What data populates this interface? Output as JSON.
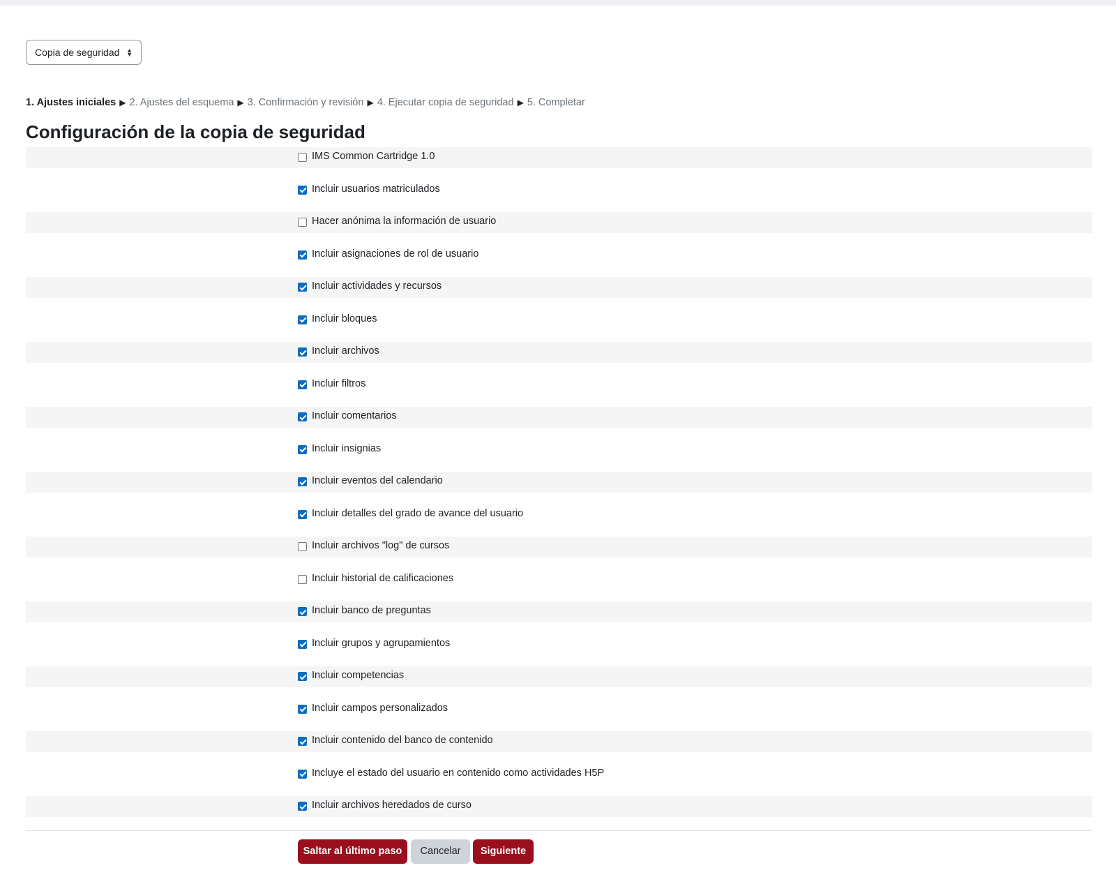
{
  "jump_select": {
    "selected": "Copia de seguridad"
  },
  "breadcrumb": {
    "steps": [
      {
        "label": "1. Ajustes iniciales",
        "current": true
      },
      {
        "label": "2. Ajustes del esquema",
        "current": false
      },
      {
        "label": "3. Confirmación y revisión",
        "current": false
      },
      {
        "label": "4. Ejecutar copia de seguridad",
        "current": false
      },
      {
        "label": "5. Completar",
        "current": false
      }
    ],
    "separator": "▶"
  },
  "page_title": "Configuración de la copia de seguridad",
  "settings": [
    {
      "label": "IMS Common Cartridge 1.0",
      "checked": false
    },
    {
      "label": "Incluir usuarios matriculados",
      "checked": true
    },
    {
      "label": "Hacer anónima la información de usuario",
      "checked": false
    },
    {
      "label": "Incluir asignaciones de rol de usuario",
      "checked": true
    },
    {
      "label": "Incluir actividades y recursos",
      "checked": true
    },
    {
      "label": "Incluir bloques",
      "checked": true
    },
    {
      "label": "Incluir archivos",
      "checked": true
    },
    {
      "label": "Incluir filtros",
      "checked": true
    },
    {
      "label": "Incluir comentarios",
      "checked": true
    },
    {
      "label": "Incluir insignias",
      "checked": true
    },
    {
      "label": "Incluir eventos del calendario",
      "checked": true
    },
    {
      "label": "Incluir detalles del grado de avance del usuario",
      "checked": true
    },
    {
      "label": "Incluir archivos \"log\" de cursos",
      "checked": false
    },
    {
      "label": "Incluir historial de calificaciones",
      "checked": false
    },
    {
      "label": "Incluir banco de preguntas",
      "checked": true
    },
    {
      "label": "Incluir grupos y agrupamientos",
      "checked": true
    },
    {
      "label": "Incluir competencias",
      "checked": true
    },
    {
      "label": "Incluir campos personalizados",
      "checked": true
    },
    {
      "label": "Incluir contenido del banco de contenido",
      "checked": true
    },
    {
      "label": "Incluye el estado del usuario en contenido como actividades H5P",
      "checked": true
    },
    {
      "label": "Incluir archivos heredados de curso",
      "checked": true
    }
  ],
  "buttons": {
    "skip_label": "Saltar al último paso",
    "cancel_label": "Cancelar",
    "next_label": "Siguiente"
  },
  "colors": {
    "primary": "#9b0e1d",
    "checkbox": "#0f6cbf",
    "secondary": "#ced4da"
  }
}
